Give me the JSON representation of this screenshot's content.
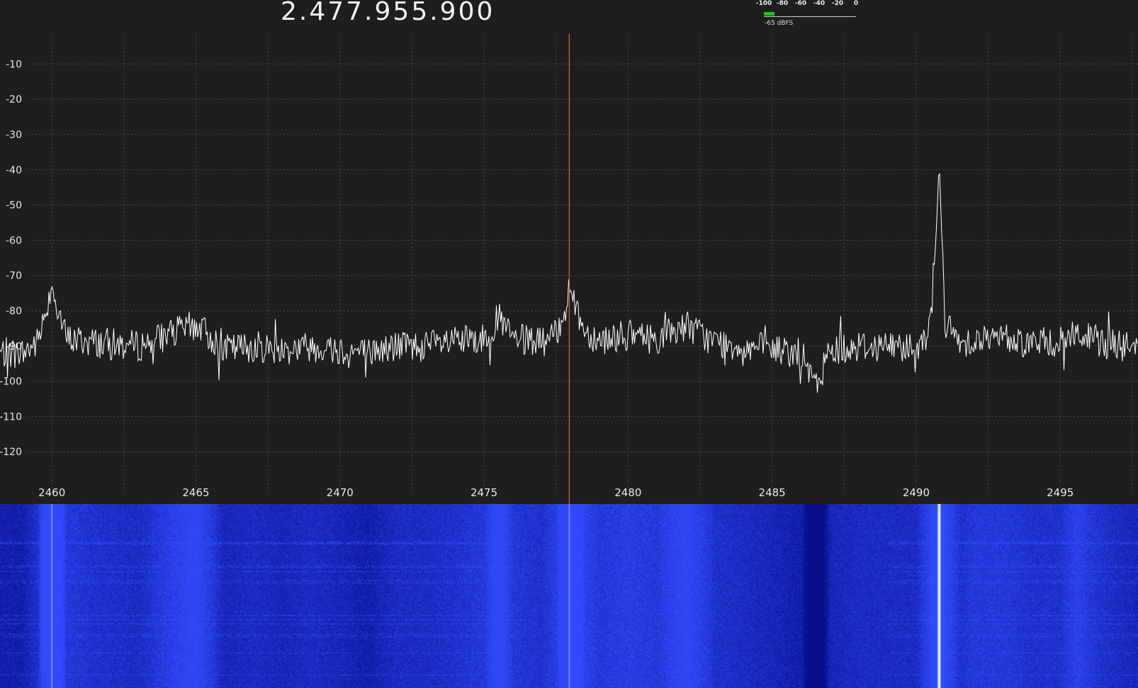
{
  "header": {
    "center_frequency": "2.477.955.900"
  },
  "level_meter": {
    "scale_labels": [
      "-100",
      "-80",
      "-60",
      "-40",
      "-20",
      "0"
    ],
    "readout": "-65 dBFS",
    "value_dbfs": -65,
    "bar_color": "#22c022"
  },
  "chart_data": {
    "type": "line",
    "title": "",
    "xlabel": "",
    "ylabel": "",
    "x_unit": "MHz",
    "xlim": [
      2458.2,
      2497.7
    ],
    "ylim": [
      -132,
      -1.5
    ],
    "x_ticks": [
      2460,
      2465,
      2470,
      2475,
      2480,
      2485,
      2490,
      2495
    ],
    "x_tick_labels": [
      "2460",
      "2465",
      "2470",
      "2475",
      "2480",
      "2485",
      "2490",
      "2495"
    ],
    "y_ticks": [
      -10,
      -20,
      -30,
      -40,
      -50,
      -60,
      -70,
      -80,
      -90,
      -100,
      -110,
      -120
    ],
    "y_tick_labels": [
      "-10",
      "-20",
      "-30",
      "-40",
      "-50",
      "-60",
      "-70",
      "-80",
      "-90",
      "-100",
      "-110",
      "-120"
    ],
    "grid": true,
    "noise_floor": -90,
    "tuned_frequency": 2477.96,
    "series": [
      {
        "x": [
          2459.0,
          2459.5,
          2460.0,
          2460.5,
          2461.5,
          2463.0,
          2465.0,
          2466.0,
          2467.0,
          2468.0,
          2469.0,
          2470.0,
          2471.0,
          2472.0,
          2473.0,
          2474.0,
          2475.0,
          2475.5,
          2476.0,
          2477.0,
          2477.5,
          2478.0,
          2478.5,
          2479.0,
          2480.0,
          2481.0,
          2482.0,
          2483.0,
          2484.0,
          2485.0,
          2486.0,
          2486.5,
          2487.0,
          2488.0,
          2489.0,
          2490.0,
          2490.5,
          2490.8,
          2491.0,
          2491.5,
          2492.0,
          2493.0,
          2494.0,
          2495.0,
          2495.6,
          2496.0,
          2497.0,
          2497.7
        ],
        "y": [
          -92,
          -89,
          -73,
          -88,
          -89,
          -90,
          -84,
          -91,
          -90,
          -91,
          -90,
          -91,
          -92,
          -90,
          -90,
          -89,
          -88,
          -82,
          -88,
          -89,
          -87,
          -74,
          -86,
          -88,
          -87,
          -88,
          -84,
          -89,
          -90,
          -91,
          -92,
          -102,
          -91,
          -90,
          -90,
          -90,
          -85,
          -38,
          -84,
          -89,
          -88,
          -88,
          -89,
          -89,
          -86,
          -88,
          -90,
          -91
        ]
      }
    ]
  },
  "colors": {
    "background": "#1e1e1f",
    "grid": "#4a4a4c",
    "trace": "#ffffff",
    "tuning_line": "#e05a4a",
    "waterfall_base": "#0a1496",
    "waterfall_signal": "#d8f0c0"
  }
}
